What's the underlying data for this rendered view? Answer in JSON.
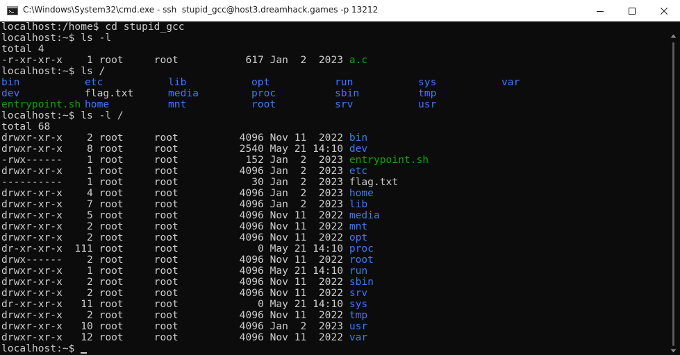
{
  "window": {
    "title": "C:\\Windows\\System32\\cmd.exe - ssh  stupid_gcc@host3.dreamhack.games -p 13212"
  },
  "colors": {
    "background": "#0c0c0c",
    "text": "#cccccc",
    "directory": "#3b78ff",
    "executable": "#13a10e"
  },
  "terminal": {
    "lines": [
      [
        {
          "t": "localhost:/home$ cd stupid_gcc",
          "c": "norm"
        }
      ],
      [
        {
          "t": "localhost:~$ ls -l",
          "c": "norm"
        }
      ],
      [
        {
          "t": "total 4",
          "c": "norm"
        }
      ],
      [
        {
          "t": "-r-xr-xr-x    1 root     root           617 Jan  2  2023 ",
          "c": "norm"
        },
        {
          "t": "a.c",
          "c": "green"
        }
      ],
      [
        {
          "t": "localhost:~$ ls /",
          "c": "norm"
        }
      ]
    ],
    "ls_grid": {
      "rows": [
        [
          {
            "t": "bin",
            "c": "blue"
          },
          {
            "t": "etc",
            "c": "blue"
          },
          {
            "t": "lib",
            "c": "blue"
          },
          {
            "t": "opt",
            "c": "blue"
          },
          {
            "t": "run",
            "c": "blue"
          },
          {
            "t": "sys",
            "c": "blue"
          },
          {
            "t": "var",
            "c": "blue"
          }
        ],
        [
          {
            "t": "dev",
            "c": "blue"
          },
          {
            "t": "flag.txt",
            "c": "norm"
          },
          {
            "t": "media",
            "c": "blue"
          },
          {
            "t": "proc",
            "c": "blue"
          },
          {
            "t": "sbin",
            "c": "blue"
          },
          {
            "t": "tmp",
            "c": "blue"
          }
        ],
        [
          {
            "t": "entrypoint.sh",
            "c": "green"
          },
          {
            "t": "home",
            "c": "blue"
          },
          {
            "t": "mnt",
            "c": "blue"
          },
          {
            "t": "root",
            "c": "blue"
          },
          {
            "t": "srv",
            "c": "blue"
          },
          {
            "t": "usr",
            "c": "blue"
          }
        ]
      ]
    },
    "lines2": [
      [
        {
          "t": "localhost:~$ ls -l /",
          "c": "norm"
        }
      ],
      [
        {
          "t": "total 68",
          "c": "norm"
        }
      ],
      [
        {
          "t": "drwxr-xr-x    2 root     root          4096 Nov 11  2022 ",
          "c": "norm"
        },
        {
          "t": "bin",
          "c": "blue"
        }
      ],
      [
        {
          "t": "drwxr-xr-x    8 root     root          2540 May 21 14:10 ",
          "c": "norm"
        },
        {
          "t": "dev",
          "c": "blue"
        }
      ],
      [
        {
          "t": "-rwx------    1 root     root           152 Jan  2  2023 ",
          "c": "norm"
        },
        {
          "t": "entrypoint.sh",
          "c": "green"
        }
      ],
      [
        {
          "t": "drwxr-xr-x    1 root     root          4096 Jan  2  2023 ",
          "c": "norm"
        },
        {
          "t": "etc",
          "c": "blue"
        }
      ],
      [
        {
          "t": "----------    1 root     root            30 Jan  2  2023 ",
          "c": "norm"
        },
        {
          "t": "flag.txt",
          "c": "norm"
        }
      ],
      [
        {
          "t": "drwxr-xr-x    4 root     root          4096 Jan  2  2023 ",
          "c": "norm"
        },
        {
          "t": "home",
          "c": "blue"
        }
      ],
      [
        {
          "t": "drwxr-xr-x    7 root     root          4096 Jan  2  2023 ",
          "c": "norm"
        },
        {
          "t": "lib",
          "c": "blue"
        }
      ],
      [
        {
          "t": "drwxr-xr-x    5 root     root          4096 Nov 11  2022 ",
          "c": "norm"
        },
        {
          "t": "media",
          "c": "blue"
        }
      ],
      [
        {
          "t": "drwxr-xr-x    2 root     root          4096 Nov 11  2022 ",
          "c": "norm"
        },
        {
          "t": "mnt",
          "c": "blue"
        }
      ],
      [
        {
          "t": "drwxr-xr-x    2 root     root          4096 Nov 11  2022 ",
          "c": "norm"
        },
        {
          "t": "opt",
          "c": "blue"
        }
      ],
      [
        {
          "t": "dr-xr-xr-x  111 root     root             0 May 21 14:10 ",
          "c": "norm"
        },
        {
          "t": "proc",
          "c": "blue"
        }
      ],
      [
        {
          "t": "drwx------    2 root     root          4096 Nov 11  2022 ",
          "c": "norm"
        },
        {
          "t": "root",
          "c": "blue"
        }
      ],
      [
        {
          "t": "drwxr-xr-x    1 root     root          4096 May 21 14:10 ",
          "c": "norm"
        },
        {
          "t": "run",
          "c": "blue"
        }
      ],
      [
        {
          "t": "drwxr-xr-x    2 root     root          4096 Nov 11  2022 ",
          "c": "norm"
        },
        {
          "t": "sbin",
          "c": "blue"
        }
      ],
      [
        {
          "t": "drwxr-xr-x    2 root     root          4096 Nov 11  2022 ",
          "c": "norm"
        },
        {
          "t": "srv",
          "c": "blue"
        }
      ],
      [
        {
          "t": "dr-xr-xr-x   11 root     root             0 May 21 14:10 ",
          "c": "norm"
        },
        {
          "t": "sys",
          "c": "blue"
        }
      ],
      [
        {
          "t": "drwxr-xr-x    2 root     root          4096 Nov 11  2022 ",
          "c": "norm"
        },
        {
          "t": "tmp",
          "c": "blue"
        }
      ],
      [
        {
          "t": "drwxr-xr-x   10 root     root          4096 Jan  2  2023 ",
          "c": "norm"
        },
        {
          "t": "usr",
          "c": "blue"
        }
      ],
      [
        {
          "t": "drwxr-xr-x   12 root     root          4096 Nov 11  2022 ",
          "c": "norm"
        },
        {
          "t": "var",
          "c": "blue"
        }
      ]
    ],
    "prompt": "localhost:~$ "
  }
}
